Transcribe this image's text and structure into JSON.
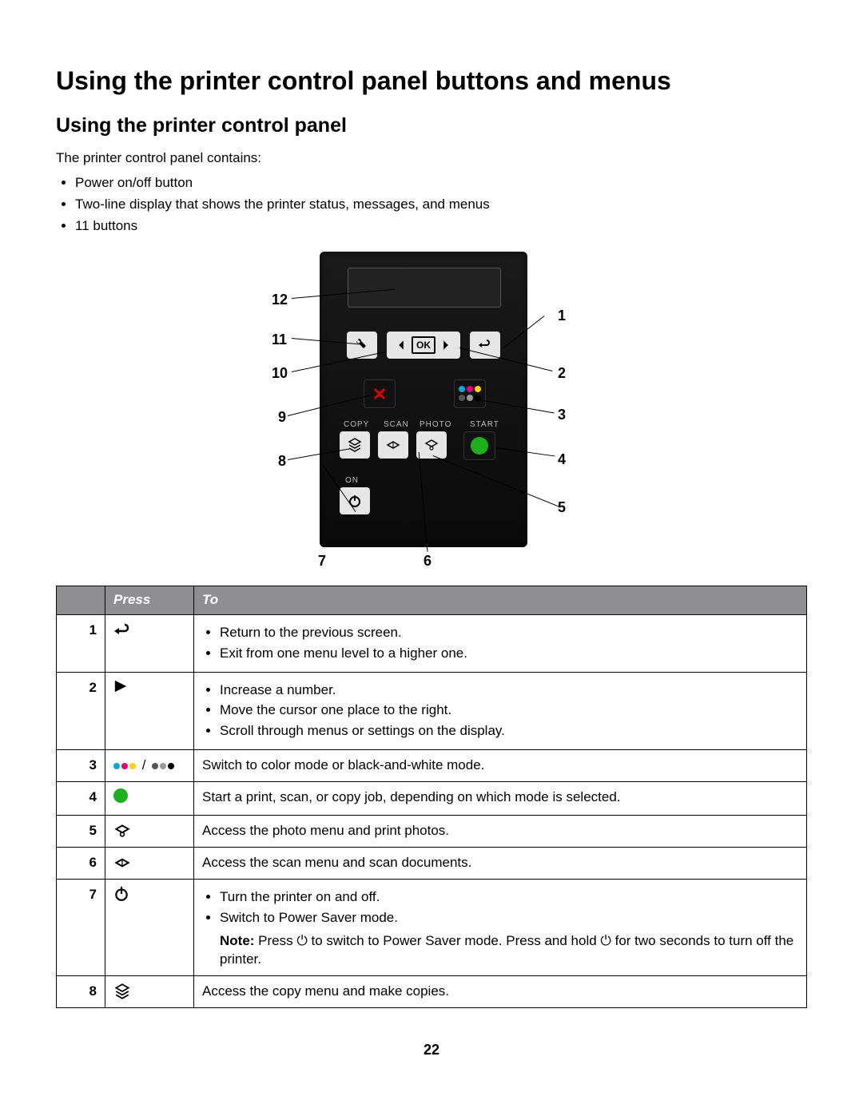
{
  "heading": "Using the printer control panel buttons and menus",
  "subheading": "Using the printer control panel",
  "intro_lead": "The printer control panel contains:",
  "intro_items": [
    "Power on/off button",
    "Two-line display that shows the printer status, messages, and menus",
    "11 buttons"
  ],
  "diagram": {
    "callouts": [
      "1",
      "2",
      "3",
      "4",
      "5",
      "6",
      "7",
      "8",
      "9",
      "10",
      "11",
      "12"
    ],
    "labels": {
      "copy": "COPY",
      "scan": "SCAN",
      "photo": "PHOTO",
      "start": "START",
      "on": "ON",
      "ok": "OK"
    }
  },
  "table": {
    "head": [
      "",
      "Press",
      "To"
    ],
    "rows": [
      {
        "num": "1",
        "icon": "back",
        "text_list": [
          "Return to the previous screen.",
          "Exit from one menu level to a higher one."
        ]
      },
      {
        "num": "2",
        "icon": "right",
        "text_list": [
          "Increase a number.",
          "Move the cursor one place to the right.",
          "Scroll through menus or settings on the display."
        ]
      },
      {
        "num": "3",
        "icon": "color-bw",
        "text": "Switch to color mode or black-and-white mode."
      },
      {
        "num": "4",
        "icon": "green",
        "text": "Start a print, scan, or copy job, depending on which mode is selected."
      },
      {
        "num": "5",
        "icon": "photo",
        "text": "Access the photo menu and print photos."
      },
      {
        "num": "6",
        "icon": "scan",
        "text": "Access the scan menu and scan documents."
      },
      {
        "num": "7",
        "icon": "power",
        "text_list": [
          "Turn the printer on and off.",
          "Switch to Power Saver mode."
        ],
        "note_prefix": "Note:",
        "note": " Press ⏻ to switch to Power Saver mode. Press and hold ⏻ for two seconds to turn off the printer."
      },
      {
        "num": "8",
        "icon": "copy",
        "text": "Access the copy menu and make copies."
      }
    ]
  },
  "page_number": "22"
}
